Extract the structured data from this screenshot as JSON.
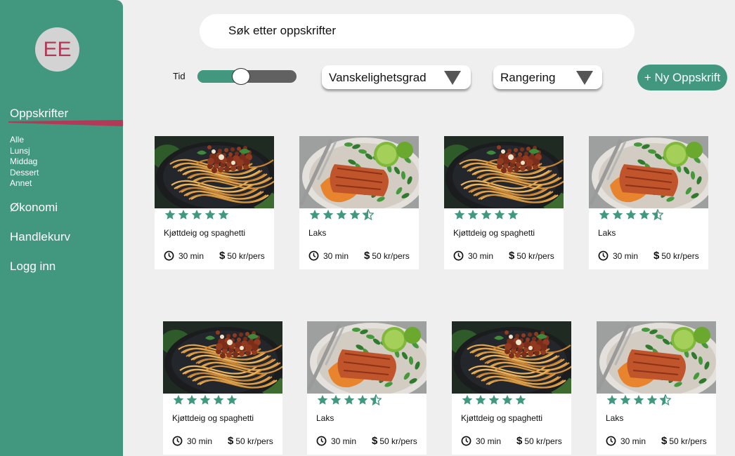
{
  "sidebar": {
    "avatar_initials": "EE",
    "nav": {
      "recipes": "Oppskrifter",
      "economy": "Økonomi",
      "cart": "Handlekurv",
      "login": "Logg inn"
    },
    "categories": [
      "Alle",
      "Lunsj",
      "Middag",
      "Dessert",
      "Annet"
    ]
  },
  "search": {
    "placeholder": "Søk etter oppskrifter"
  },
  "filters": {
    "time_label": "Tid",
    "time_slider_fraction": 0.44,
    "difficulty": "Vanskelighetsgrad",
    "rating": "Rangering"
  },
  "new_recipe": "+ Ny Oppskrift",
  "colors": {
    "primary": "#42987f",
    "accent": "#b03a57",
    "background": "#efefef"
  },
  "cards": [
    {
      "dish": "spaghetti",
      "title": "Kjøttdeig og spaghetti",
      "rating": 5,
      "time": "30 min",
      "price": "50 kr/pers"
    },
    {
      "dish": "salmon",
      "title": "Laks",
      "rating": 4.5,
      "time": "30 min",
      "price": "50 kr/pers"
    },
    {
      "dish": "spaghetti",
      "title": "Kjøttdeig og spaghetti",
      "rating": 5,
      "time": "30 min",
      "price": "50 kr/pers"
    },
    {
      "dish": "salmon",
      "title": "Laks",
      "rating": 4.5,
      "time": "30 min",
      "price": "50 kr/pers"
    },
    {
      "dish": "spaghetti",
      "title": "Kjøttdeig og spaghetti",
      "rating": 5,
      "time": "30 min",
      "price": "50 kr/pers"
    },
    {
      "dish": "salmon",
      "title": "Laks",
      "rating": 4.5,
      "time": "30 min",
      "price": "50 kr/pers"
    },
    {
      "dish": "spaghetti",
      "title": "Kjøttdeig og spaghetti",
      "rating": 5,
      "time": "30 min",
      "price": "50 kr/pers"
    },
    {
      "dish": "salmon",
      "title": "Laks",
      "rating": 4.5,
      "time": "30 min",
      "price": "50 kr/pers"
    }
  ]
}
